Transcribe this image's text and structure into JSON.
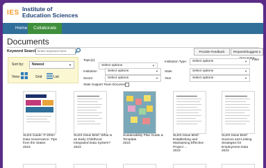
{
  "brand": {
    "logo_mark": "IES",
    "line1": "Institute of",
    "line2": "Education Sciences"
  },
  "nav": {
    "items": [
      "Home",
      "Collaborate"
    ]
  },
  "page_title": "Documents",
  "keyword_search": {
    "label": "Keyword Search:",
    "placeholder": "Enter keyword here"
  },
  "actions": {
    "feedback": "Provide Feedback",
    "request": "Request/Suggest a Document"
  },
  "sort": {
    "label": "Sort by:",
    "value": "Newest"
  },
  "view": {
    "label": "View:",
    "grid": "Grid",
    "list": "List"
  },
  "filters": {
    "topic_label": "Topic(s):",
    "topic_value": "Select options",
    "institution_type_label": "Institution Type:",
    "institution_type_value": "Select options",
    "institution_label": "Institution",
    "institution_value": "Select options",
    "state_label": "State",
    "state_value": "Select options",
    "sector_label": "Sector",
    "sector_value": "Select options",
    "year_label": "Year",
    "year_value": "Select options",
    "support_team_label": "State Support Team Documents",
    "filter_button": "Filter"
  },
  "documents": [
    {
      "title": "SLDS Guide: P-20W+ Data Governance: Tips from the States",
      "year": "2023"
    },
    {
      "title": "SLDS Issue Brief: What Is an Early Childhood Integrated Data System?",
      "year": "2023"
    },
    {
      "title": "Sustainability Plan Guide & Template",
      "year": "2023"
    },
    {
      "title": "SLDS Issue Brief: Establishing and Maintaining Effective Project ...",
      "year": "2023"
    },
    {
      "title": "SLDS Issue Brief: Sources and Linking Strategies for Employment Data",
      "year": "2023"
    }
  ],
  "colors": {
    "frame": "#5b2c87",
    "nav": "#2f6f9a",
    "collaborate_active": "#3f8e3c",
    "sort_panel": "#fbf7d2",
    "logo_orange": "#f29b2c"
  }
}
